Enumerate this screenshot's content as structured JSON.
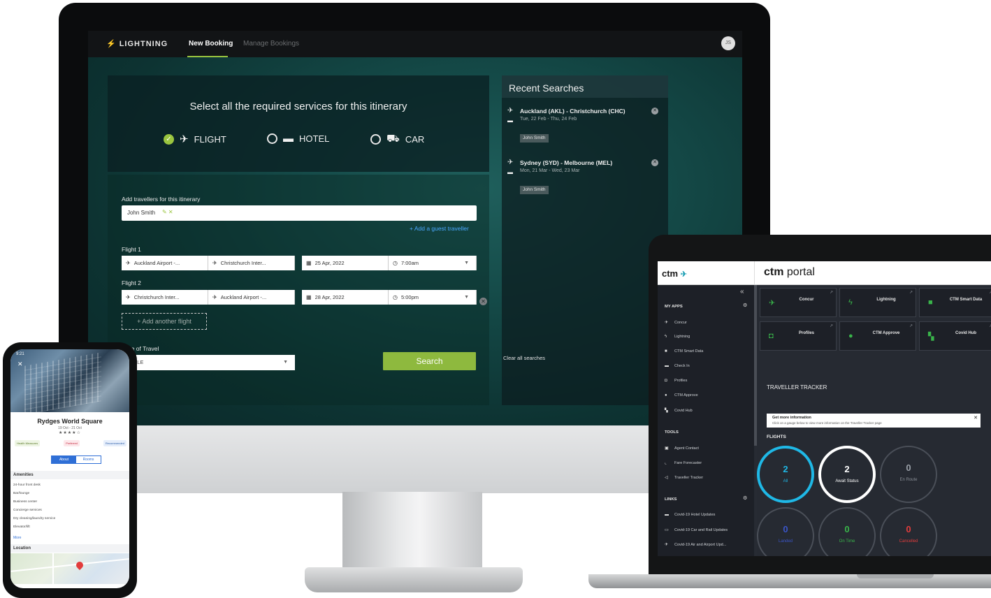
{
  "desktop_app": {
    "brand": "LIGHTNING",
    "nav": {
      "new_booking": "New Booking",
      "manage_bookings": "Manage Bookings"
    },
    "user_initials": "JS",
    "services": {
      "title": "Select all the required services for this itinerary",
      "options": [
        {
          "label": "FLIGHT",
          "checked": true,
          "icon": "plane-icon"
        },
        {
          "label": "HOTEL",
          "checked": false,
          "icon": "bed-icon"
        },
        {
          "label": "CAR",
          "checked": false,
          "icon": "car-icon"
        }
      ]
    },
    "travellers": {
      "label": "Add travellers for this itinerary",
      "chip": "John Smith",
      "add_guest": "Add a guest traveller"
    },
    "flights": [
      {
        "label": "Flight 1",
        "from": "Auckland Airport -...",
        "to": "Christchurch Inter...",
        "date": "25 Apr, 2022",
        "time": "7:00am"
      },
      {
        "label": "Flight 2",
        "from": "Christchurch Inter...",
        "to": "Auckland Airport -...",
        "date": "28 Apr, 2022",
        "time": "5:00pm"
      }
    ],
    "add_flight": "+ Add another flight",
    "type_of_travel": {
      "label": "Type of Travel",
      "value": "LABLE"
    },
    "search_button": "Search",
    "recent": {
      "title": "Recent Searches",
      "items": [
        {
          "route": "Auckland (AKL) - Christchurch (CHC)",
          "dates": "Tue, 22 Feb - Thu, 24 Feb",
          "traveller": "John Smith"
        },
        {
          "route": "Sydney (SYD) - Melbourne (MEL)",
          "dates": "Mon, 21 Mar - Wed, 23 Mar",
          "traveller": "John Smith"
        }
      ],
      "clear": "Clear all searches"
    }
  },
  "phone_app": {
    "status": "9:21",
    "hotel_name": "Rydges World Square",
    "dates": "19 Oct - 21 Oct",
    "stars": "★★★★☆",
    "tags": [
      "Health Measures",
      "Preferred",
      "Recommended"
    ],
    "tabs": [
      "About",
      "Rooms"
    ],
    "amenities_title": "Amenities",
    "amenities": [
      "24-hour front desk",
      "Bar/lounge",
      "Business center",
      "Concierge services",
      "Dry cleaning/laundry service",
      "Elevator/lift"
    ],
    "more": "More",
    "location_title": "Location"
  },
  "laptop_app": {
    "logo": "ctm",
    "portal_title_bold": "ctm",
    "portal_title_rest": " portal",
    "sidebar": {
      "my_apps_title": "MY APPS",
      "my_apps": [
        "Concur",
        "Lightning",
        "CTM Smart Data",
        "Check In",
        "Profiles",
        "CTM Approve",
        "Covid Hub"
      ],
      "tools_title": "TOOLS",
      "tools": [
        "Agent Contact",
        "Fare Forecaster",
        "Traveller Tracker"
      ],
      "links_title": "LINKS",
      "links": [
        "Covid-19 Hotel Updates",
        "Covid-19 Car and Rail Updates",
        "Covid-19 Air and Airport Upd..."
      ]
    },
    "tiles": [
      "Concur",
      "Lightning",
      "CTM Smart Data",
      "Profiles",
      "CTM Approve",
      "Covid Hub"
    ],
    "tracker_title": "TRAVELLER TRACKER",
    "info": {
      "title": "Get more information",
      "text": "Click on a gauge below to view more information on the Traveller Tracker page"
    },
    "flights_title": "FLIGHTS",
    "gauges": [
      {
        "value": "2",
        "label": "All",
        "color": "#1fb8e6"
      },
      {
        "value": "2",
        "label": "Await Status",
        "color": "#ffffff"
      },
      {
        "value": "0",
        "label": "En Route",
        "color": "#6b7079"
      },
      {
        "value": "0",
        "label": "Landed",
        "color": "#3a55c8"
      },
      {
        "value": "0",
        "label": "On Time",
        "color": "#39b44a"
      },
      {
        "value": "0",
        "label": "Cancelled",
        "color": "#e23c3c"
      }
    ]
  },
  "colors": {
    "accent_green": "#9ac53f",
    "link_blue": "#4aa8ff",
    "portal_bg": "#262a32"
  }
}
